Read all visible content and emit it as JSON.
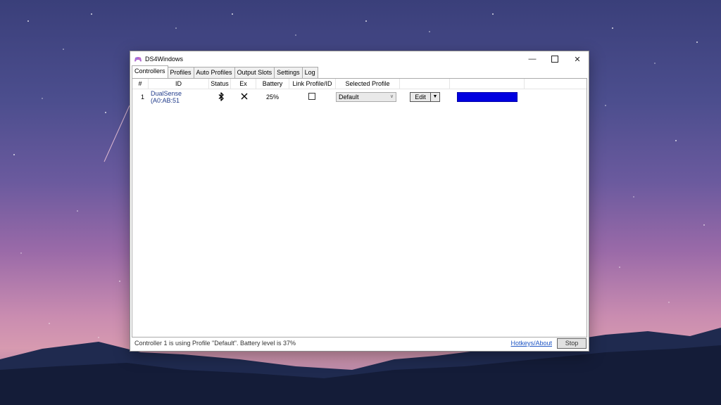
{
  "window": {
    "title": "DS4Windows"
  },
  "tabs": [
    {
      "label": "Controllers",
      "active": true
    },
    {
      "label": "Profiles"
    },
    {
      "label": "Auto Profiles"
    },
    {
      "label": "Output Slots"
    },
    {
      "label": "Settings"
    },
    {
      "label": "Log"
    }
  ],
  "grid": {
    "headers": [
      "#",
      "ID",
      "Status",
      "Ex",
      "Battery",
      "Link Profile/ID",
      "Selected Profile",
      "",
      "",
      ""
    ],
    "rows": [
      {
        "num": "1",
        "id": "DualSense (A0:AB:51",
        "status_icon": "bluetooth-icon",
        "exclusive_icon": "x-icon",
        "battery": "25%",
        "linked": false,
        "selected_profile": "Default",
        "edit_label": "Edit",
        "lightbar_color": "#0000e0"
      }
    ]
  },
  "statusbar": {
    "message": "Controller 1 is using Profile \"Default\". Battery level is 37%",
    "hotkeys_label": "Hotkeys/About",
    "stop_label": "Stop"
  }
}
